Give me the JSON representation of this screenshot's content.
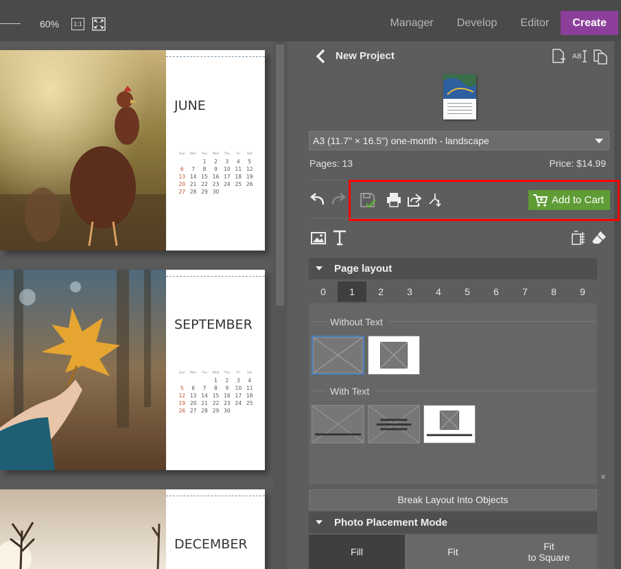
{
  "toolbar": {
    "zoom": "60%",
    "one_to_one": "1:1",
    "modes": [
      "Manager",
      "Develop",
      "Editor",
      "Create"
    ],
    "active_mode": "Create"
  },
  "calendar_pages": [
    {
      "month": "JUNE",
      "photo": "hen",
      "weekdays": [
        "Sun",
        "Mon",
        "Tue",
        "Wed",
        "Thu",
        "Fri",
        "Sat"
      ],
      "weeks": [
        [
          "",
          "",
          "",
          "1",
          "2",
          "3",
          "4",
          "5"
        ],
        [
          "6",
          "7",
          "8",
          "9",
          "10",
          "11",
          "12"
        ],
        [
          "13",
          "14",
          "15",
          "16",
          "17",
          "18",
          "19"
        ],
        [
          "20",
          "21",
          "22",
          "23",
          "24",
          "25",
          "26"
        ],
        [
          "27",
          "28",
          "29",
          "30",
          "",
          "",
          ""
        ]
      ]
    },
    {
      "month": "SEPTEMBER",
      "photo": "leaf",
      "weekdays": [
        "Sun",
        "Mon",
        "Tue",
        "Wed",
        "Thu",
        "Fri",
        "Sat"
      ],
      "weeks": [
        [
          "",
          "",
          "",
          "1",
          "2",
          "3",
          "4"
        ],
        [
          "5",
          "6",
          "7",
          "8",
          "9",
          "10",
          "11"
        ],
        [
          "12",
          "13",
          "14",
          "15",
          "16",
          "17",
          "18"
        ],
        [
          "19",
          "20",
          "21",
          "22",
          "23",
          "24",
          "25"
        ],
        [
          "26",
          "27",
          "28",
          "29",
          "30",
          "",
          ""
        ]
      ]
    },
    {
      "month": "DECEMBER",
      "photo": "tree"
    }
  ],
  "project": {
    "title": "New Project",
    "format": "A3 (11.7\" × 16.5\") one-month - landscape",
    "pages": "Pages: 13",
    "price": "Price: $14.99",
    "add_to_cart": "Add to Cart"
  },
  "page_layout": {
    "title": "Page layout",
    "numbers": [
      "0",
      "1",
      "2",
      "3",
      "4",
      "5",
      "6",
      "7",
      "8",
      "9"
    ],
    "selected": "1",
    "without_text": "Without Text",
    "with_text": "With Text"
  },
  "break_layout": "Break Layout Into Objects",
  "photo_placement": {
    "title": "Photo Placement Mode",
    "fill": "Fill",
    "fit": "Fit",
    "fit_square_1": "Fit",
    "fit_square_2": "to Square"
  },
  "colors": {
    "create_accent": "#8b3f9b",
    "cart_green": "#5f9c35",
    "highlight_red": "#ff0000"
  }
}
